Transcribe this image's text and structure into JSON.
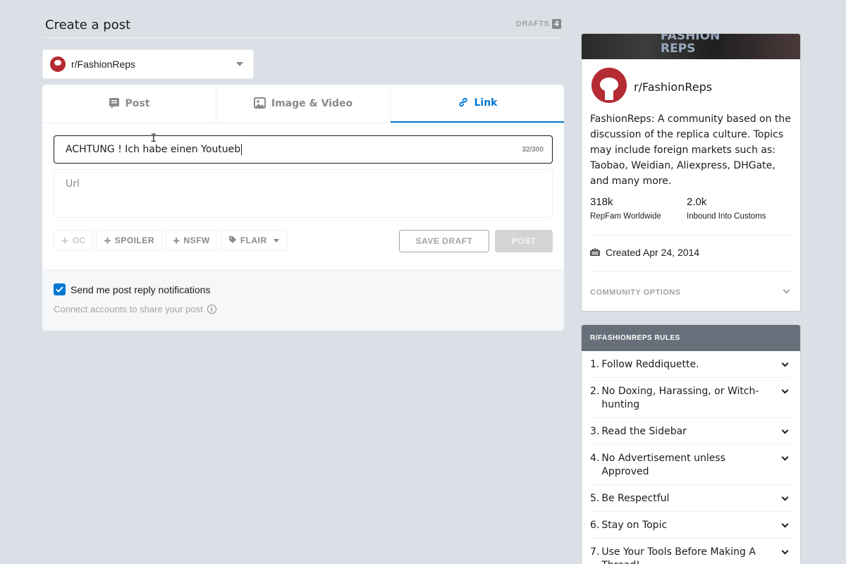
{
  "header": {
    "title": "Create a post",
    "drafts_label": "DRAFTS",
    "drafts_count": "4"
  },
  "community_selector": {
    "name": "r/FashionReps"
  },
  "tabs": [
    {
      "label": "Post",
      "icon": "post-icon"
    },
    {
      "label": "Image & Video",
      "icon": "image-icon"
    },
    {
      "label": "Link",
      "icon": "link-icon",
      "active": true
    }
  ],
  "form": {
    "title_value": "ACHTUNG ! Ich habe einen Youtueb",
    "char_count": "32/300",
    "url_placeholder": "Url",
    "tags": [
      {
        "label": "OC",
        "disabled": true
      },
      {
        "label": "SPOILER"
      },
      {
        "label": "NSFW"
      },
      {
        "label": "FLAIR"
      }
    ],
    "save_draft_label": "SAVE DRAFT",
    "post_label": "POST",
    "notify_label": "Send me post reply notifications",
    "connect_label": "Connect accounts to share your post"
  },
  "community_card": {
    "banner_text": "FASHION\nREPS",
    "name": "r/FashionReps",
    "description": "FashionReps: A community based on the discussion of the replica culture. Topics may include foreign markets such as: Taobao, Weidian, Aliexpress, DHGate, and many more.",
    "stats": [
      {
        "value": "318k",
        "label": "RepFam Worldwide"
      },
      {
        "value": "2.0k",
        "label": "Inbound Into Customs"
      }
    ],
    "created": "Created Apr 24, 2014",
    "options_label": "COMMUNITY OPTIONS"
  },
  "rules": {
    "header": "R/FASHIONREPS RULES",
    "items": [
      {
        "num": "1.",
        "text": "Follow Reddiquette."
      },
      {
        "num": "2.",
        "text": "No Doxing, Harassing, or Witch-hunting"
      },
      {
        "num": "3.",
        "text": "Read the Sidebar"
      },
      {
        "num": "4.",
        "text": "No Advertisement unless Approved"
      },
      {
        "num": "5.",
        "text": "Be Respectful"
      },
      {
        "num": "6.",
        "text": "Stay on Topic"
      },
      {
        "num": "7.",
        "text": "Use Your Tools Before Making A Thread!"
      }
    ]
  },
  "colors": {
    "accent": "#0079d3",
    "background": "#dae0e6",
    "rules_header": "#676f7a"
  }
}
